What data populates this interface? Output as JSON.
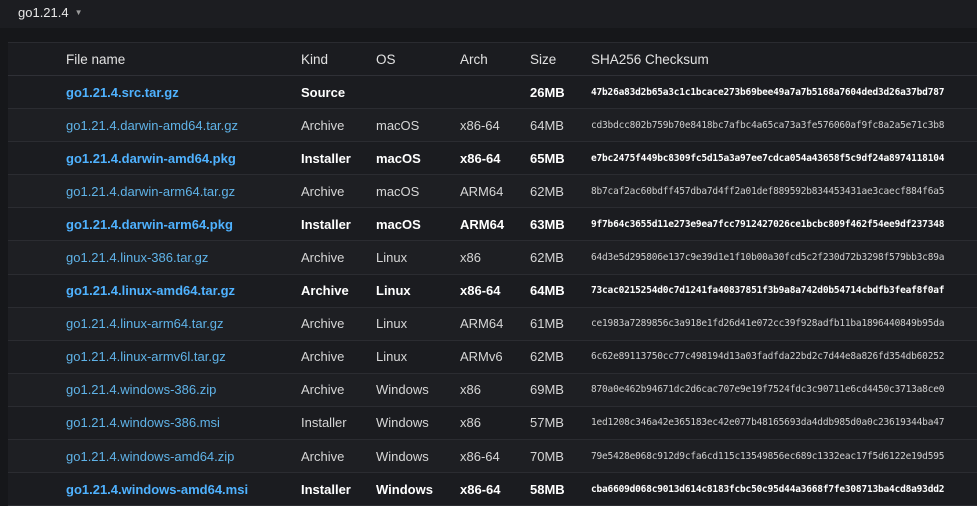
{
  "version_header": {
    "title": "go1.21.4",
    "chevron_icon": "chevron-down-icon"
  },
  "table": {
    "columns": [
      "File name",
      "Kind",
      "OS",
      "Arch",
      "Size",
      "SHA256 Checksum"
    ],
    "rows": [
      {
        "file": "go1.21.4.src.tar.gz",
        "kind": "Source",
        "os": "",
        "arch": "",
        "size": "26MB",
        "checksum": "47b26a83d2b65a3c1c1bcace273b69bee49a7a7b5168a7604ded3d26a37bd787",
        "featured": true
      },
      {
        "file": "go1.21.4.darwin-amd64.tar.gz",
        "kind": "Archive",
        "os": "macOS",
        "arch": "x86-64",
        "size": "64MB",
        "checksum": "cd3bdcc802b759b70e8418bc7afbc4a65ca73a3fe576060af9fc8a2a5e71c3b8",
        "featured": false
      },
      {
        "file": "go1.21.4.darwin-amd64.pkg",
        "kind": "Installer",
        "os": "macOS",
        "arch": "x86-64",
        "size": "65MB",
        "checksum": "e7bc2475f449bc8309fc5d15a3a97ee7cdca054a43658f5c9df24a8974118104",
        "featured": true
      },
      {
        "file": "go1.21.4.darwin-arm64.tar.gz",
        "kind": "Archive",
        "os": "macOS",
        "arch": "ARM64",
        "size": "62MB",
        "checksum": "8b7caf2ac60bdff457dba7d4ff2a01def889592b834453431ae3caecf884f6a5",
        "featured": false
      },
      {
        "file": "go1.21.4.darwin-arm64.pkg",
        "kind": "Installer",
        "os": "macOS",
        "arch": "ARM64",
        "size": "63MB",
        "checksum": "9f7b64c3655d11e273e9ea7fcc7912427026ce1bcbc809f462f54ee9df237348",
        "featured": true
      },
      {
        "file": "go1.21.4.linux-386.tar.gz",
        "kind": "Archive",
        "os": "Linux",
        "arch": "x86",
        "size": "62MB",
        "checksum": "64d3e5d295806e137c9e39d1e1f10b00a30fcd5c2f230d72b3298f579bb3c89a",
        "featured": false
      },
      {
        "file": "go1.21.4.linux-amd64.tar.gz",
        "kind": "Archive",
        "os": "Linux",
        "arch": "x86-64",
        "size": "64MB",
        "checksum": "73cac0215254d0c7d1241fa40837851f3b9a8a742d0b54714cbdfb3feaf8f0af",
        "featured": true
      },
      {
        "file": "go1.21.4.linux-arm64.tar.gz",
        "kind": "Archive",
        "os": "Linux",
        "arch": "ARM64",
        "size": "61MB",
        "checksum": "ce1983a7289856c3a918e1fd26d41e072cc39f928adfb11ba1896440849b95da",
        "featured": false
      },
      {
        "file": "go1.21.4.linux-armv6l.tar.gz",
        "kind": "Archive",
        "os": "Linux",
        "arch": "ARMv6",
        "size": "62MB",
        "checksum": "6c62e89113750cc77c498194d13a03fadfda22bd2c7d44e8a826fd354db60252",
        "featured": false
      },
      {
        "file": "go1.21.4.windows-386.zip",
        "kind": "Archive",
        "os": "Windows",
        "arch": "x86",
        "size": "69MB",
        "checksum": "870a0e462b94671dc2d6cac707e9e19f7524fdc3c90711e6cd4450c3713a8ce0",
        "featured": false
      },
      {
        "file": "go1.21.4.windows-386.msi",
        "kind": "Installer",
        "os": "Windows",
        "arch": "x86",
        "size": "57MB",
        "checksum": "1ed1208c346a42e365183ec42e077b48165693da4ddb985d0a0c23619344ba47",
        "featured": false
      },
      {
        "file": "go1.21.4.windows-amd64.zip",
        "kind": "Archive",
        "os": "Windows",
        "arch": "x86-64",
        "size": "70MB",
        "checksum": "79e5428e068c912d9cfa6cd115c13549856ec689c1332eac17f5d6122e19d595",
        "featured": false
      },
      {
        "file": "go1.21.4.windows-amd64.msi",
        "kind": "Installer",
        "os": "Windows",
        "arch": "x86-64",
        "size": "58MB",
        "checksum": "cba6609d068c9013d614c8183fcbc50c95d44a3668f7fe308713ba4cd8a93dd2",
        "featured": true
      }
    ]
  }
}
